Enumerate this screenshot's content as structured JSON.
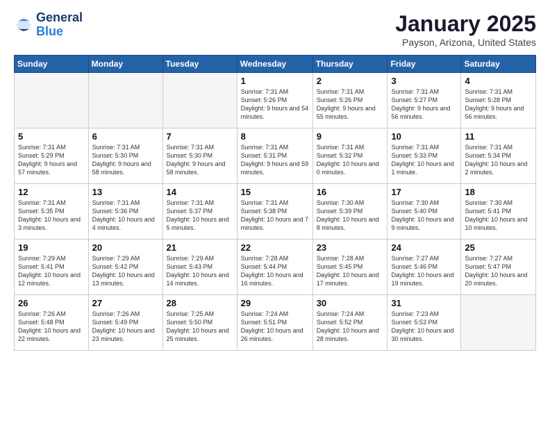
{
  "header": {
    "logo_general": "General",
    "logo_blue": "Blue",
    "title": "January 2025",
    "subtitle": "Payson, Arizona, United States"
  },
  "days_of_week": [
    "Sunday",
    "Monday",
    "Tuesday",
    "Wednesday",
    "Thursday",
    "Friday",
    "Saturday"
  ],
  "weeks": [
    [
      {
        "day": "",
        "info": ""
      },
      {
        "day": "",
        "info": ""
      },
      {
        "day": "",
        "info": ""
      },
      {
        "day": "1",
        "info": "Sunrise: 7:31 AM\nSunset: 5:26 PM\nDaylight: 9 hours\nand 54 minutes."
      },
      {
        "day": "2",
        "info": "Sunrise: 7:31 AM\nSunset: 5:26 PM\nDaylight: 9 hours\nand 55 minutes."
      },
      {
        "day": "3",
        "info": "Sunrise: 7:31 AM\nSunset: 5:27 PM\nDaylight: 9 hours\nand 56 minutes."
      },
      {
        "day": "4",
        "info": "Sunrise: 7:31 AM\nSunset: 5:28 PM\nDaylight: 9 hours\nand 56 minutes."
      }
    ],
    [
      {
        "day": "5",
        "info": "Sunrise: 7:31 AM\nSunset: 5:29 PM\nDaylight: 9 hours\nand 57 minutes."
      },
      {
        "day": "6",
        "info": "Sunrise: 7:31 AM\nSunset: 5:30 PM\nDaylight: 9 hours\nand 58 minutes."
      },
      {
        "day": "7",
        "info": "Sunrise: 7:31 AM\nSunset: 5:30 PM\nDaylight: 9 hours\nand 58 minutes."
      },
      {
        "day": "8",
        "info": "Sunrise: 7:31 AM\nSunset: 5:31 PM\nDaylight: 9 hours\nand 59 minutes."
      },
      {
        "day": "9",
        "info": "Sunrise: 7:31 AM\nSunset: 5:32 PM\nDaylight: 10 hours\nand 0 minutes."
      },
      {
        "day": "10",
        "info": "Sunrise: 7:31 AM\nSunset: 5:33 PM\nDaylight: 10 hours\nand 1 minute."
      },
      {
        "day": "11",
        "info": "Sunrise: 7:31 AM\nSunset: 5:34 PM\nDaylight: 10 hours\nand 2 minutes."
      }
    ],
    [
      {
        "day": "12",
        "info": "Sunrise: 7:31 AM\nSunset: 5:35 PM\nDaylight: 10 hours\nand 3 minutes."
      },
      {
        "day": "13",
        "info": "Sunrise: 7:31 AM\nSunset: 5:36 PM\nDaylight: 10 hours\nand 4 minutes."
      },
      {
        "day": "14",
        "info": "Sunrise: 7:31 AM\nSunset: 5:37 PM\nDaylight: 10 hours\nand 5 minutes."
      },
      {
        "day": "15",
        "info": "Sunrise: 7:31 AM\nSunset: 5:38 PM\nDaylight: 10 hours\nand 7 minutes."
      },
      {
        "day": "16",
        "info": "Sunrise: 7:30 AM\nSunset: 5:39 PM\nDaylight: 10 hours\nand 8 minutes."
      },
      {
        "day": "17",
        "info": "Sunrise: 7:30 AM\nSunset: 5:40 PM\nDaylight: 10 hours\nand 9 minutes."
      },
      {
        "day": "18",
        "info": "Sunrise: 7:30 AM\nSunset: 5:41 PM\nDaylight: 10 hours\nand 10 minutes."
      }
    ],
    [
      {
        "day": "19",
        "info": "Sunrise: 7:29 AM\nSunset: 5:41 PM\nDaylight: 10 hours\nand 12 minutes."
      },
      {
        "day": "20",
        "info": "Sunrise: 7:29 AM\nSunset: 5:42 PM\nDaylight: 10 hours\nand 13 minutes."
      },
      {
        "day": "21",
        "info": "Sunrise: 7:29 AM\nSunset: 5:43 PM\nDaylight: 10 hours\nand 14 minutes."
      },
      {
        "day": "22",
        "info": "Sunrise: 7:28 AM\nSunset: 5:44 PM\nDaylight: 10 hours\nand 16 minutes."
      },
      {
        "day": "23",
        "info": "Sunrise: 7:28 AM\nSunset: 5:45 PM\nDaylight: 10 hours\nand 17 minutes."
      },
      {
        "day": "24",
        "info": "Sunrise: 7:27 AM\nSunset: 5:46 PM\nDaylight: 10 hours\nand 19 minutes."
      },
      {
        "day": "25",
        "info": "Sunrise: 7:27 AM\nSunset: 5:47 PM\nDaylight: 10 hours\nand 20 minutes."
      }
    ],
    [
      {
        "day": "26",
        "info": "Sunrise: 7:26 AM\nSunset: 5:48 PM\nDaylight: 10 hours\nand 22 minutes."
      },
      {
        "day": "27",
        "info": "Sunrise: 7:26 AM\nSunset: 5:49 PM\nDaylight: 10 hours\nand 23 minutes."
      },
      {
        "day": "28",
        "info": "Sunrise: 7:25 AM\nSunset: 5:50 PM\nDaylight: 10 hours\nand 25 minutes."
      },
      {
        "day": "29",
        "info": "Sunrise: 7:24 AM\nSunset: 5:51 PM\nDaylight: 10 hours\nand 26 minutes."
      },
      {
        "day": "30",
        "info": "Sunrise: 7:24 AM\nSunset: 5:52 PM\nDaylight: 10 hours\nand 28 minutes."
      },
      {
        "day": "31",
        "info": "Sunrise: 7:23 AM\nSunset: 5:53 PM\nDaylight: 10 hours\nand 30 minutes."
      },
      {
        "day": "",
        "info": ""
      }
    ]
  ]
}
